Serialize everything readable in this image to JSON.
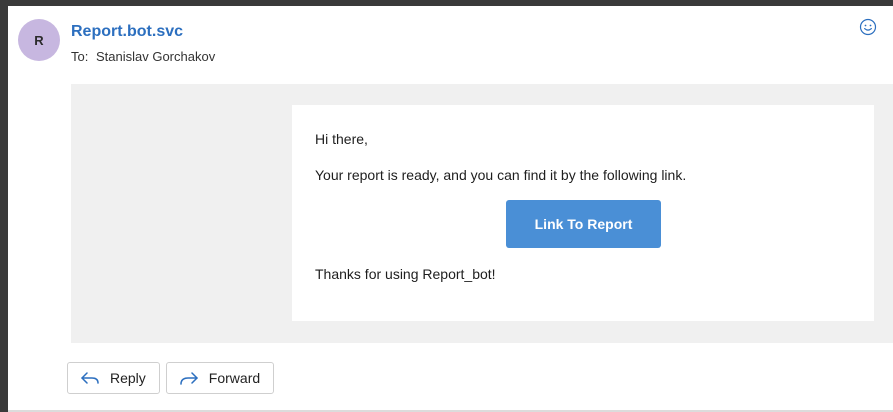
{
  "message": {
    "avatar_initial": "R",
    "sender": "Report.bot.svc",
    "to_label": "To:",
    "recipient": "Stanislav Gorchakov",
    "emoji_icon": "smiley-icon"
  },
  "email_body": {
    "greeting": "Hi there,",
    "message": "Your report is ready, and you can find it by the following link.",
    "button_label": "Link To Report",
    "closing": "Thanks for using Report_bot!"
  },
  "actions": {
    "reply_label": "Reply",
    "reply_icon": "reply-arrow-icon",
    "forward_label": "Forward",
    "forward_icon": "forward-arrow-icon"
  },
  "colors": {
    "sender": "#2c6fbf",
    "avatar": "#c7b7e0",
    "button": "#4a8fd6",
    "body_background": "#f0f0f0"
  }
}
